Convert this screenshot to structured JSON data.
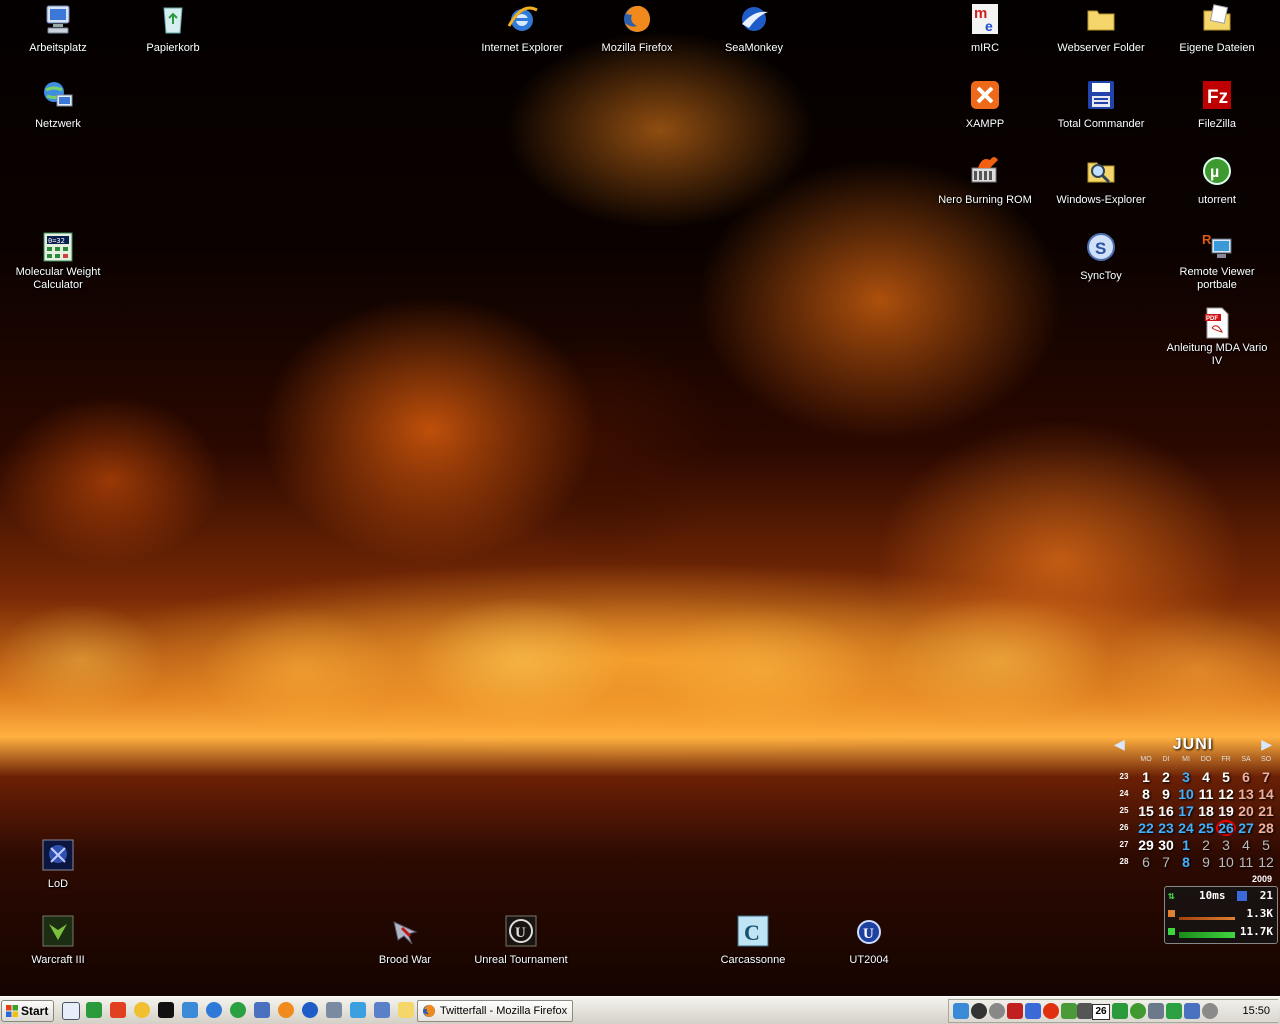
{
  "desktop": {
    "icons": {
      "arbeitsplatz": "Arbeitsplatz",
      "papierkorb": "Papierkorb",
      "netzwerk": "Netzwerk",
      "molecular": "Molecular Weight\nCalculator",
      "ie": "Internet Explorer",
      "firefox": "Mozilla Firefox",
      "seamonkey": "SeaMonkey",
      "mirc": "mIRC",
      "webserver": "Webserver Folder",
      "eigene": "Eigene Dateien",
      "xampp": "XAMPP",
      "totalcmd": "Total Commander",
      "filezilla": "FileZilla",
      "nero": "Nero Burning ROM",
      "winexplorer": "Windows-Explorer",
      "utorrent": "utorrent",
      "synctoy": "SyncToy",
      "remoteviewer": "Remote Viewer\nportbale",
      "anleitung": "Anleitung MDA Vario IV",
      "lod": "LoD",
      "warcraft": "Warcraft III",
      "broodwar": "Brood War",
      "unreal": "Unreal Tournament",
      "carcassonne": "Carcassonne",
      "ut2004": "UT2004"
    }
  },
  "calendar": {
    "month": "JUNI",
    "year": "2009",
    "prev": "◀",
    "next": "▶",
    "weekdays": [
      "MO",
      "DI",
      "MI",
      "DO",
      "FR",
      "SA",
      "SO"
    ],
    "weeks": [
      {
        "wk": "23",
        "days": [
          "1",
          "2",
          "3",
          "4",
          "5",
          "6",
          "7"
        ]
      },
      {
        "wk": "24",
        "days": [
          "8",
          "9",
          "10",
          "11",
          "12",
          "13",
          "14"
        ]
      },
      {
        "wk": "25",
        "days": [
          "15",
          "16",
          "17",
          "18",
          "19",
          "20",
          "21"
        ]
      },
      {
        "wk": "26",
        "days": [
          "22",
          "23",
          "24",
          "25",
          "26",
          "27",
          "28"
        ]
      },
      {
        "wk": "27",
        "days": [
          "29",
          "30",
          "1",
          "2",
          "3",
          "4",
          "5"
        ]
      },
      {
        "wk": "28",
        "days": [
          "6",
          "7",
          "8",
          "9",
          "10",
          "11",
          "12"
        ]
      }
    ],
    "today": "26"
  },
  "netmeter": {
    "ping": "10ms",
    "count": "21",
    "upload": "1.3K",
    "download": "11.7K"
  },
  "taskbar": {
    "start_label": "Start",
    "active_task": "Twitterfall - Mozilla Firefox",
    "tray_number": "26",
    "clock": "15:50"
  },
  "colors": {
    "accent_today": "#e00000",
    "calendar_blue": "#40b0ff"
  }
}
